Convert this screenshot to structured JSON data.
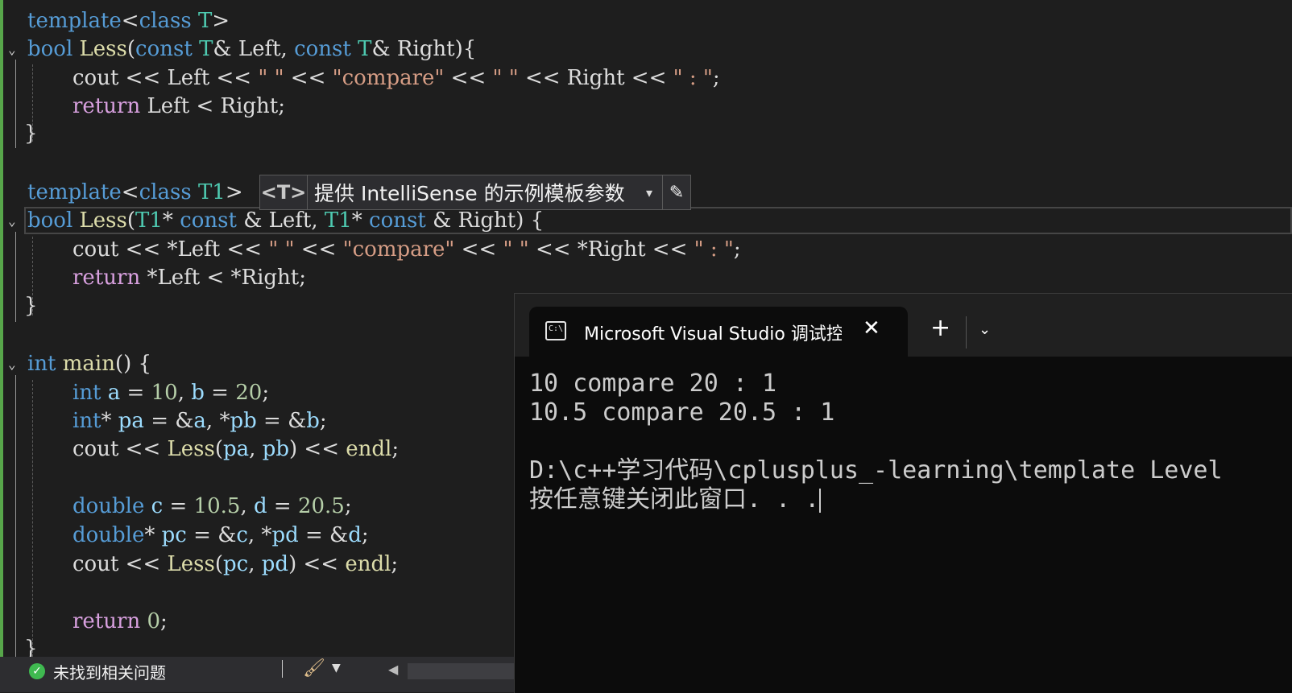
{
  "editor": {
    "lines": {
      "l1": [
        "template<class T>"
      ],
      "t1": {
        "template": "template",
        "lt": "<",
        "cls": "class",
        "T": "T",
        "gt": ">"
      },
      "fn1": {
        "bool": "bool",
        "name": "Less",
        "p1": "(",
        "c1": "const",
        "t1": "T",
        "a1": "& Left, ",
        "c2": "const",
        "t2": "T",
        "a2": "& Right){"
      },
      "fn1_cout": {
        "cout": "cout << Left << ",
        "s1": "\" \"",
        "o1": " << ",
        "s2": "\"compare\"",
        "o2": " << ",
        "s3": "\" \"",
        "o3": " << Right << ",
        "s4": "\" : \"",
        "end": ";"
      },
      "fn1_ret": {
        "kw": "return",
        "rest": " Left < Right;"
      },
      "fn1_close": "}",
      "t2": {
        "template": "template",
        "lt": "<",
        "cls": "class",
        "T": "T1",
        "gt": ">"
      },
      "fn2": {
        "bool": "bool",
        "name": "Less",
        "p1": "(",
        "t1": "T1",
        "a1": "* ",
        "c1": "const",
        "a2": " & Left, ",
        "t2": "T1",
        "a3": "* ",
        "c2": "const",
        "a4": " & Right) {"
      },
      "fn2_cout": {
        "cout": "cout << *Left << ",
        "s1": "\" \"",
        "o1": " << ",
        "s2": "\"compare\"",
        "o2": " << ",
        "s3": "\" \"",
        "o3": " << *Right << ",
        "s4": "\" : \"",
        "end": ";"
      },
      "fn2_ret": {
        "kw": "return",
        "rest": " *Left < *Right;"
      },
      "fn2_close": "}",
      "main": {
        "int": "int",
        "name": " main",
        "rest": "() {"
      },
      "m1": {
        "kw": "int",
        "a": " a",
        "eq1": " = ",
        "n1": "10",
        "c": ", ",
        "b": "b",
        "eq2": " = ",
        "n2": "20",
        "end": ";"
      },
      "m2": {
        "kw": "int",
        "rest1": "* ",
        "pa": "pa",
        "rest2": " = &",
        "a": "a",
        "rest3": ", *",
        "pb": "pb",
        "rest4": " = &",
        "b": "b",
        "end": ";"
      },
      "m3": {
        "cout": "cout << ",
        "fn": "Less",
        "p": "(",
        "pa": "pa",
        "c": ", ",
        "pb": "pb",
        "rest": ") << ",
        "endl": "endl",
        "end": ";"
      },
      "m4": {
        "kw": "double",
        "c": " c",
        "eq1": " = ",
        "n1": "10.5",
        "cm": ", ",
        "d": "d",
        "eq2": " = ",
        "n2": "20.5",
        "end": ";"
      },
      "m5": {
        "kw": "double",
        "rest1": "* ",
        "pc": "pc",
        "rest2": " = &",
        "c": "c",
        "rest3": ", *",
        "pd": "pd",
        "rest4": " = &",
        "d": "d",
        "end": ";"
      },
      "m6": {
        "cout": "cout << ",
        "fn": "Less",
        "p": "(",
        "pc": "pc",
        "c": ", ",
        "pd": "pd",
        "rest": ") << ",
        "endl": "endl",
        "end": ";"
      },
      "m7": {
        "kw": "return",
        "sp": " ",
        "n": "0",
        "end": ";"
      },
      "main_close": "}"
    }
  },
  "intellisense_hint": {
    "tag": "<T>",
    "text": "提供 IntelliSense 的示例模板参数",
    "dropdown": "▾",
    "edit": "✎"
  },
  "status_bar": {
    "message": "未找到相关问题",
    "check": "✓"
  },
  "terminal": {
    "tab_title": "Microsoft Visual Studio 调试控制台",
    "icon_text": "C:\\",
    "close": "✕",
    "new_tab": "+",
    "dropdown": "⌄",
    "output": [
      "10 compare 20 : 1",
      "10.5 compare 20.5 : 1",
      "",
      "D:\\c++学习代码\\cplusplus_-learning\\template Level",
      "按任意键关闭此窗口. . ."
    ]
  },
  "colors": {
    "keyword": "#569cd6",
    "type": "#4ec9b0",
    "function": "#dcdcaa",
    "string": "#d69d85",
    "number": "#b5cea8",
    "control": "#d8a0df",
    "variable": "#9cdcfe"
  }
}
